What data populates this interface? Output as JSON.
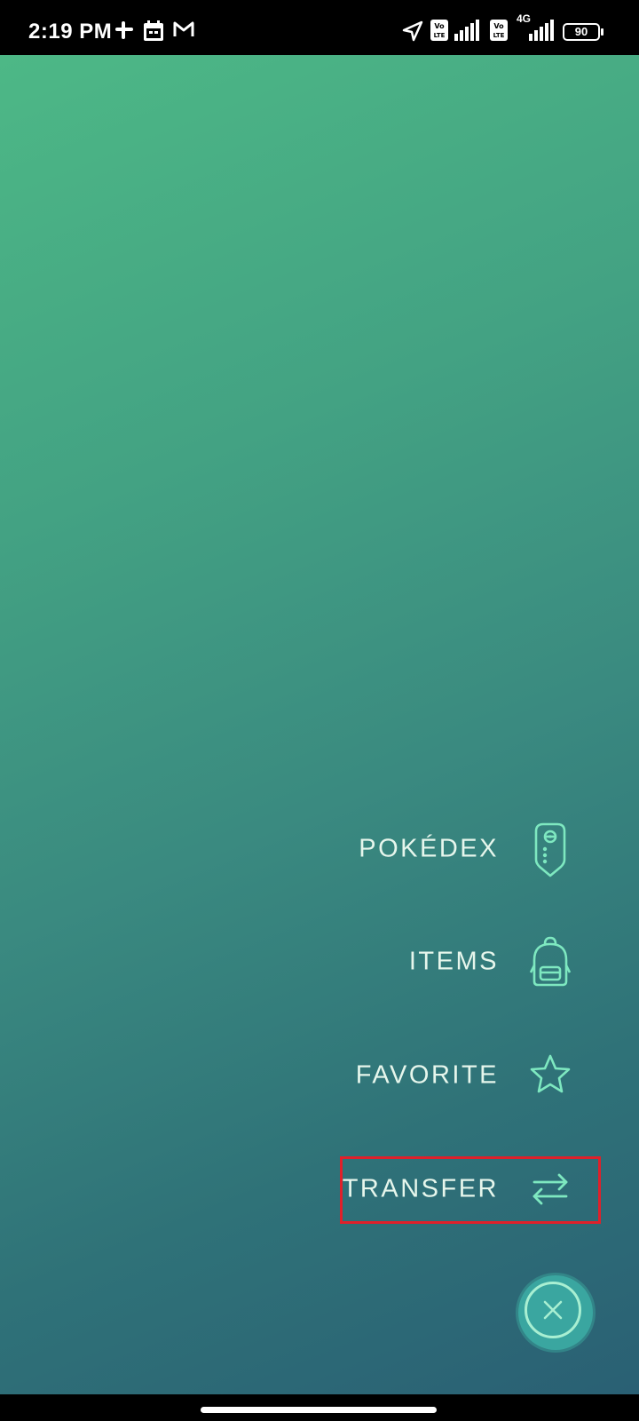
{
  "status_bar": {
    "time": "2:19 PM",
    "network_label": "4G",
    "battery": "90",
    "icons": [
      "slack-icon",
      "calendar-icon",
      "gmail-icon",
      "location-icon",
      "volte-icon",
      "signal-icon",
      "volte-icon",
      "signal-icon",
      "battery-icon"
    ]
  },
  "menu": {
    "items": [
      {
        "label": "POKÉDEX",
        "icon": "pokedex-icon"
      },
      {
        "label": "ITEMS",
        "icon": "backpack-icon"
      },
      {
        "label": "FAVORITE",
        "icon": "star-icon"
      },
      {
        "label": "TRANSFER",
        "icon": "transfer-arrows-icon"
      }
    ],
    "close_icon": "close-icon"
  },
  "colors": {
    "accent_icon": "#7ee8c0",
    "label_text": "#e6f6ec",
    "highlight_border": "#e0202a",
    "gradient_top": "#4db886",
    "gradient_bottom": "#2a6074"
  }
}
